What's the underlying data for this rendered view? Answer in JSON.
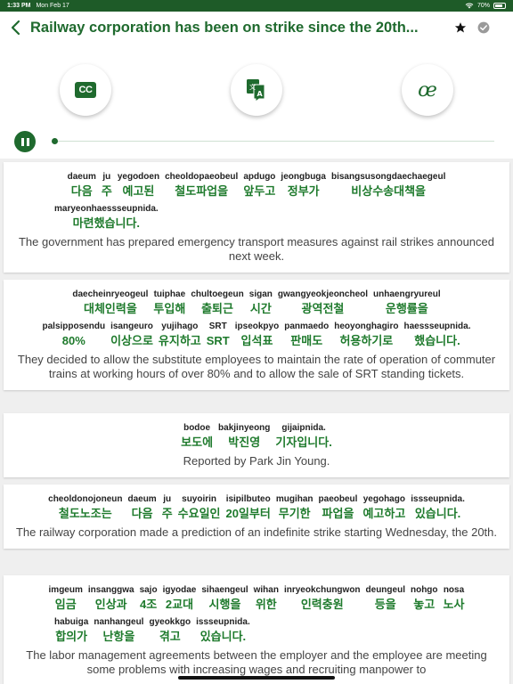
{
  "status_bar": {
    "time": "1:33 PM",
    "date": "Mon Feb 17",
    "battery": "70%"
  },
  "header": {
    "title": "Railway corporation has been on strike since the 20th..."
  },
  "tools": {
    "cc_label": "CC",
    "oe_label": "œ"
  },
  "sentences": [
    {
      "lines": [
        [
          [
            "daeum",
            "다음"
          ],
          [
            "ju",
            "주"
          ],
          [
            "yegodoen",
            "예고된"
          ],
          [
            "cheoldopaeobeul",
            "철도파업을"
          ],
          [
            "apdugo",
            "앞두고"
          ],
          [
            "jeongbuga",
            "정부가"
          ],
          [
            "bisangsusongdaechaegeul",
            "비상수송대책을"
          ]
        ],
        [
          [
            "maryeonhaessseupnida.",
            "마련했습니다."
          ]
        ]
      ],
      "translation": "The government has prepared emergency transport measures against rail strikes announced next week."
    },
    {
      "lines": [
        [
          [
            "daecheinryeogeul",
            "대체인력을"
          ],
          [
            "tuiphae",
            "투입해"
          ],
          [
            "chultoegeun",
            "출퇴근"
          ],
          [
            "sigan",
            "시간"
          ],
          [
            "gwangyeokjeoncheol",
            "광역전철"
          ],
          [
            "unhaengryureul",
            "운행률을"
          ]
        ],
        [
          [
            "palsipposendu",
            "80%"
          ],
          [
            "isangeuro",
            "이상으로"
          ],
          [
            "yujihago",
            "유지하고"
          ],
          [
            "SRT",
            "SRT"
          ],
          [
            "ipseokpyo",
            "입석표"
          ],
          [
            "panmaedo",
            "판매도"
          ],
          [
            "heoyonghagiro",
            "허용하기로"
          ],
          [
            "haessseupnida.",
            "했습니다."
          ]
        ]
      ],
      "translation": "They decided to allow the substitute employees to maintain the rate of operation of commuter trains at working hours of over 80% and to allow the sale of SRT standing tickets."
    },
    {
      "lines": [
        [
          [
            "bodoe",
            "보도에"
          ],
          [
            "bakjinyeong",
            "박진영"
          ],
          [
            "gijaipnida.",
            "기자입니다."
          ]
        ]
      ],
      "translation": "Reported by Park Jin Young."
    },
    {
      "lines": [
        [
          [
            "cheoldonojoneun",
            "철도노조는"
          ],
          [
            "daeum",
            "다음"
          ],
          [
            "ju",
            "주"
          ],
          [
            "suyoirin",
            "수요일인"
          ],
          [
            "isipilbuteo",
            "20일부터"
          ],
          [
            "mugihan",
            "무기한"
          ],
          [
            "paeobeul",
            "파업을"
          ],
          [
            "yegohago",
            "예고하고"
          ],
          [
            "issseupnida.",
            "있습니다."
          ]
        ]
      ],
      "translation": "The railway corporation made a prediction of an indefinite strike starting Wednesday, the 20th."
    },
    {
      "lines": [
        [
          [
            "imgeum",
            "임금"
          ],
          [
            "insanggwa",
            "인상과"
          ],
          [
            "sajo",
            "4조"
          ],
          [
            "igyodae",
            "2교대"
          ],
          [
            "sihaengeul",
            "시행을"
          ],
          [
            "wihan",
            "위한"
          ],
          [
            "inryeokchungwon",
            "인력충원"
          ],
          [
            "deungeul",
            "등을"
          ],
          [
            "nohgo",
            "놓고"
          ],
          [
            "nosa",
            "노사"
          ]
        ],
        [
          [
            "habuiga",
            "합의가"
          ],
          [
            "nanhangeul",
            "난항을"
          ],
          [
            "gyeokkgo",
            "겪고"
          ],
          [
            "issseupnida.",
            "있습니다."
          ]
        ]
      ],
      "translation": "The labor management agreements between the employer and the employee are meeting some problems with increasing wages and recruiting manpower to"
    }
  ]
}
